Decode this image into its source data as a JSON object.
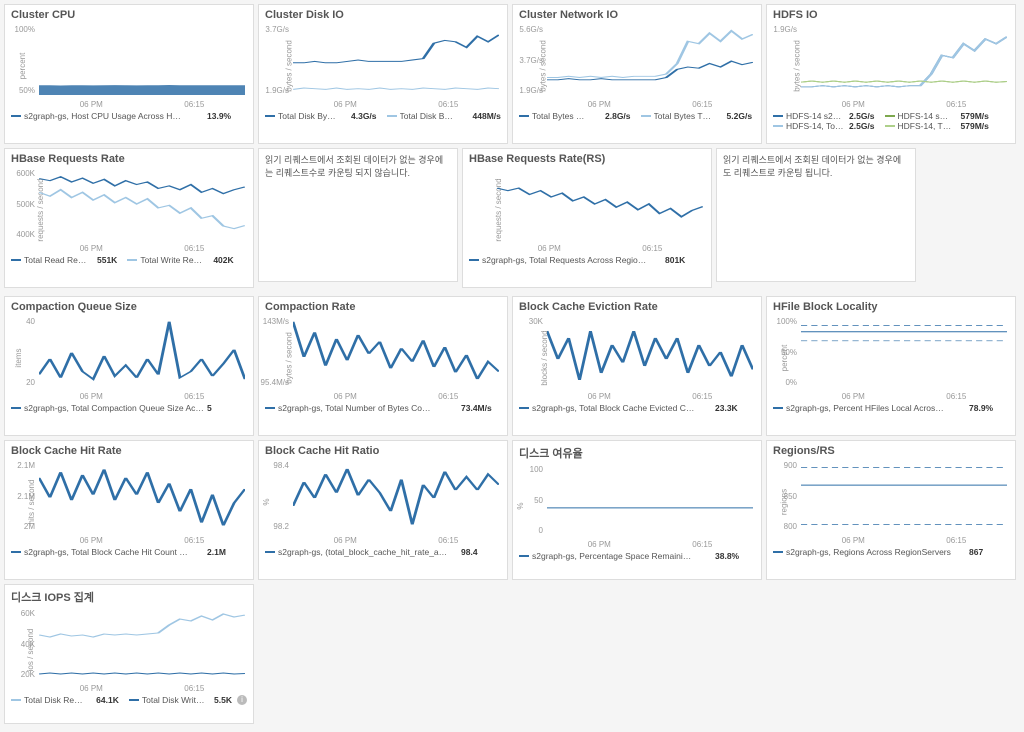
{
  "chart_data": [
    {
      "type": "area",
      "id": "cluster-cpu",
      "title": "Cluster CPU",
      "ylabel": "percent",
      "xticks": [
        "06 PM",
        "06:15"
      ],
      "yticks": [
        "100%",
        "50%"
      ],
      "series": [
        {
          "name": "s2graph-gs, Host CPU Usage Across H…",
          "color": "#2f6fa7",
          "value": "13.9%",
          "values": [
            14,
            14,
            13.5,
            14,
            14,
            13.8,
            14,
            14.1,
            14,
            13.7,
            14,
            14,
            14.2,
            14,
            14,
            13.9,
            14,
            14,
            14,
            14
          ]
        }
      ],
      "ylim": [
        0,
        100
      ]
    },
    {
      "type": "line",
      "id": "cluster-disk-io",
      "title": "Cluster Disk IO",
      "ylabel": "bytes / second",
      "xticks": [
        "06 PM",
        "06:15"
      ],
      "yticks": [
        "3.7G/s",
        "1.9G/s"
      ],
      "series": [
        {
          "name": "Total Disk By…",
          "color": "#2f6fa7",
          "value": "4.3G/s",
          "values": [
            2.3,
            2.3,
            2.4,
            2.3,
            2.3,
            2.4,
            2.5,
            2.4,
            2.4,
            2.4,
            2.4,
            2.5,
            2.6,
            3.7,
            3.9,
            3.8,
            3.4,
            4.2,
            3.8,
            4.3
          ]
        },
        {
          "name": "Total Disk B…",
          "color": "#9fc6e3",
          "value": "448M/s",
          "values": [
            0.4,
            0.5,
            0.45,
            0.4,
            0.5,
            0.4,
            0.45,
            0.4,
            0.5,
            0.4,
            0.45,
            0.4,
            0.5,
            0.45,
            0.4,
            0.5,
            0.45,
            0.4,
            0.5,
            0.45
          ]
        }
      ],
      "ylim": [
        0,
        5
      ]
    },
    {
      "type": "line",
      "id": "cluster-net-io",
      "title": "Cluster Network IO",
      "ylabel": "bytes / second",
      "xticks": [
        "06 PM",
        "06:15"
      ],
      "yticks": [
        "5.6G/s",
        "3.7G/s",
        "1.9G/s"
      ],
      "series": [
        {
          "name": "Total Bytes …",
          "color": "#2f6fa7",
          "value": "2.8G/s",
          "values": [
            1.3,
            1.3,
            1.4,
            1.3,
            1.3,
            1.4,
            1.3,
            1.3,
            1.3,
            1.3,
            1.3,
            1.5,
            2.2,
            2.4,
            2.3,
            2.7,
            2.4,
            2.9,
            2.6,
            2.8
          ]
        },
        {
          "name": "Total Bytes T…",
          "color": "#9fc6e3",
          "value": "5.2G/s",
          "values": [
            1.5,
            1.5,
            1.6,
            1.5,
            1.6,
            1.5,
            1.6,
            1.5,
            1.6,
            1.6,
            1.6,
            1.8,
            2.7,
            4.6,
            4.4,
            5.3,
            4.6,
            5.5,
            4.8,
            5.2
          ]
        }
      ],
      "ylim": [
        0,
        6
      ]
    },
    {
      "type": "line",
      "id": "hdfs-io",
      "title": "HDFS IO",
      "ylabel": "bytes / second",
      "xticks": [
        "06 PM",
        "06:15"
      ],
      "yticks": [
        "1.9G/s"
      ],
      "legend_cols": 2,
      "series": [
        {
          "name": "HDFS-14 s2…",
          "color": "#2f6fa7",
          "value": "2.5G/s",
          "values": [
            0.35,
            0.35,
            0.4,
            0.35,
            0.4,
            0.35,
            0.4,
            0.35,
            0.4,
            0.35,
            0.4,
            0.4,
            0.9,
            1.7,
            1.6,
            2.2,
            1.9,
            2.4,
            2.2,
            2.5
          ]
        },
        {
          "name": "HDFS-14 s…",
          "color": "#7da84e",
          "value": "579M/s",
          "values": [
            0.55,
            0.6,
            0.55,
            0.6,
            0.55,
            0.6,
            0.55,
            0.6,
            0.55,
            0.6,
            0.55,
            0.6,
            0.55,
            0.6,
            0.55,
            0.6,
            0.55,
            0.6,
            0.55,
            0.58
          ]
        },
        {
          "name": "HDFS-14, To…",
          "color": "#9fc6e3",
          "value": "2.5G/s",
          "values": [
            0.35,
            0.35,
            0.4,
            0.35,
            0.4,
            0.35,
            0.4,
            0.35,
            0.4,
            0.35,
            0.4,
            0.4,
            0.9,
            1.7,
            1.6,
            2.2,
            1.9,
            2.4,
            2.2,
            2.5
          ]
        },
        {
          "name": "HDFS-14, T…",
          "color": "#aed08a",
          "value": "579M/s",
          "values": [
            0.55,
            0.6,
            0.55,
            0.6,
            0.55,
            0.6,
            0.55,
            0.6,
            0.55,
            0.6,
            0.55,
            0.6,
            0.55,
            0.6,
            0.55,
            0.6,
            0.55,
            0.6,
            0.55,
            0.58
          ]
        }
      ],
      "ylim": [
        0,
        3
      ]
    },
    {
      "type": "line",
      "id": "hbase-req-rate",
      "title": "HBase Requests Rate",
      "ylabel": "requests / second",
      "xticks": [
        "06 PM",
        "06:15"
      ],
      "yticks": [
        "600K",
        "500K",
        "400K"
      ],
      "note": "읽기 리퀘스트에서 조회된 데이터가 없는 경우에는 리퀘스트수로 카운팅 되지 않습니다.",
      "series": [
        {
          "name": "Total Read Re…",
          "color": "#2f6fa7",
          "value": "551K",
          "values": [
            583,
            575,
            590,
            570,
            585,
            565,
            580,
            555,
            575,
            560,
            570,
            545,
            555,
            540,
            560,
            530,
            545,
            525,
            540,
            551
          ]
        },
        {
          "name": "Total Write Re…",
          "color": "#9fc6e3",
          "value": "402K",
          "values": [
            530,
            515,
            540,
            510,
            530,
            500,
            520,
            490,
            510,
            485,
            505,
            470,
            480,
            450,
            470,
            430,
            440,
            400,
            390,
            402
          ]
        }
      ],
      "ylim": [
        350,
        620
      ]
    },
    {
      "type": "line",
      "id": "hbase-req-rate-rs",
      "title": "HBase Requests Rate(RS)",
      "ylabel": "requests / second",
      "xticks": [
        "06 PM",
        "06:15"
      ],
      "yticks": [],
      "note": "읽기 리퀘스트에서 조회된 데이터가 없는 경우에도 리퀘스트로 카운팅 됩니다.",
      "series": [
        {
          "name": "s2graph-gs, Total Requests Across Regio…",
          "color": "#2f6fa7",
          "value": "801K",
          "values": [
            830,
            826,
            830,
            820,
            826,
            816,
            822,
            810,
            816,
            805,
            812,
            800,
            808,
            796,
            805,
            790,
            798,
            785,
            795,
            801
          ]
        }
      ],
      "ylim": [
        750,
        860
      ]
    },
    {
      "type": "line",
      "id": "compaction-queue",
      "title": "Compaction Queue Size",
      "ylabel": "items",
      "xticks": [
        "06 PM",
        "06:15"
      ],
      "yticks": [
        "40",
        "20"
      ],
      "series": [
        {
          "name": "s2graph-gs, Total Compaction Queue Size Ac…",
          "color": "#2f6fa7",
          "value": "5",
          "values": [
            8,
            18,
            6,
            22,
            10,
            5,
            20,
            7,
            14,
            6,
            18,
            8,
            42,
            6,
            10,
            18,
            7,
            15,
            24,
            5
          ]
        }
      ],
      "ylim": [
        0,
        45
      ]
    },
    {
      "type": "line",
      "id": "compaction-rate",
      "title": "Compaction Rate",
      "ylabel": "bytes / second",
      "xticks": [
        "06 PM",
        "06:15"
      ],
      "yticks": [
        "143M/s",
        "95.4M/s"
      ],
      "series": [
        {
          "name": "s2graph-gs, Total Number of Bytes Co…",
          "color": "#2f6fa7",
          "value": "73.4M/s",
          "values": [
            148,
            95,
            132,
            82,
            122,
            90,
            128,
            100,
            118,
            78,
            108,
            88,
            120,
            80,
            110,
            72,
            98,
            62,
            88,
            73
          ]
        }
      ],
      "ylim": [
        50,
        155
      ]
    },
    {
      "type": "line",
      "id": "block-evict",
      "title": "Block Cache Eviction Rate",
      "ylabel": "blocks / second",
      "xticks": [
        "06 PM",
        "06:15"
      ],
      "yticks": [
        "30K"
      ],
      "series": [
        {
          "name": "s2graph-gs, Total Block Cache Evicted C…",
          "color": "#2f6fa7",
          "value": "23.3K",
          "values": [
            34,
            26,
            32,
            20,
            34,
            22,
            30,
            25,
            34,
            24,
            32,
            26,
            32,
            22,
            30,
            24,
            28,
            21,
            30,
            23
          ]
        }
      ],
      "ylim": [
        18,
        38
      ]
    },
    {
      "type": "line",
      "id": "hfile-locality",
      "title": "HFile Block Locality",
      "ylabel": "percent",
      "xticks": [
        "06 PM",
        "06:15"
      ],
      "yticks": [
        "100%",
        "50%",
        "0%"
      ],
      "dashed": true,
      "series": [
        {
          "name": "s2graph-gs, Percent HFiles Local Acros…",
          "color": "#2f6fa7",
          "value": "78.9%",
          "values": [
            79,
            79,
            79,
            79,
            79,
            79,
            79,
            79,
            79,
            79,
            79,
            79,
            79,
            79,
            79,
            79,
            79,
            79,
            79,
            79
          ]
        }
      ],
      "extra_lines": [
        {
          "values": [
            88,
            88,
            88,
            88,
            88,
            88,
            88,
            88,
            88,
            88,
            88,
            88,
            88,
            88,
            88,
            88,
            88,
            88,
            88,
            88
          ],
          "dash": true
        },
        {
          "values": [
            66,
            66,
            66,
            66,
            66,
            66,
            66,
            66,
            66,
            66,
            66,
            66,
            66,
            66,
            66,
            66,
            66,
            66,
            66,
            66
          ],
          "dash": true
        }
      ],
      "ylim": [
        0,
        100
      ]
    },
    {
      "type": "line",
      "id": "block-hit-rate",
      "title": "Block Cache Hit Rate",
      "ylabel": "hits / second",
      "xticks": [
        "06 PM",
        "06:15"
      ],
      "yticks": [
        "2.1M",
        "2.1M",
        "2M"
      ],
      "series": [
        {
          "name": "s2graph-gs, Total Block Cache Hit Count …",
          "color": "#2f6fa7",
          "value": "2.1M",
          "values": [
            2.14,
            2.07,
            2.16,
            2.06,
            2.15,
            2.08,
            2.17,
            2.06,
            2.14,
            2.08,
            2.16,
            2.05,
            2.12,
            2.02,
            2.1,
            1.98,
            2.08,
            1.97,
            2.05,
            2.1
          ]
        }
      ],
      "ylim": [
        1.95,
        2.2
      ]
    },
    {
      "type": "line",
      "id": "block-hit-ratio",
      "title": "Block Cache Hit Ratio",
      "ylabel": "%",
      "xticks": [
        "06 PM",
        "06:15"
      ],
      "yticks": [
        "98.4",
        "98.2"
      ],
      "series": [
        {
          "name": "s2graph-gs, (total_block_cache_hit_rate_a…",
          "color": "#2f6fa7",
          "value": "98.4",
          "values": [
            98.24,
            98.42,
            98.3,
            98.48,
            98.34,
            98.52,
            98.32,
            98.44,
            98.34,
            98.2,
            98.44,
            98.1,
            98.4,
            98.3,
            98.5,
            98.36,
            98.46,
            98.36,
            98.48,
            98.4
          ]
        }
      ],
      "ylim": [
        98.05,
        98.58
      ]
    },
    {
      "type": "line",
      "id": "disk-free",
      "title": "디스크 여유율",
      "ylabel": "%",
      "xticks": [
        "06 PM",
        "06:15"
      ],
      "yticks": [
        "100",
        "50",
        "0"
      ],
      "series": [
        {
          "name": "s2graph-gs, Percentage Space Remaini…",
          "color": "#2f6fa7",
          "value": "38.8%",
          "values": [
            38.8,
            38.8,
            38.8,
            38.8,
            38.8,
            38.8,
            38.8,
            38.8,
            38.8,
            38.8,
            38.8,
            38.8,
            38.8,
            38.8,
            38.8,
            38.8,
            38.8,
            38.8,
            38.8,
            38.8
          ]
        }
      ],
      "ylim": [
        0,
        100
      ]
    },
    {
      "type": "line",
      "id": "regions-rs",
      "title": "Regions/RS",
      "ylabel": "regions",
      "xticks": [
        "06 PM",
        "06:15"
      ],
      "yticks": [
        "900",
        "850",
        "800"
      ],
      "series": [
        {
          "name": "s2graph-gs, Regions Across RegionServers",
          "color": "#2f6fa7",
          "value": "867",
          "values": [
            867,
            867,
            867,
            867,
            867,
            867,
            867,
            867,
            867,
            867,
            867,
            867,
            867,
            867,
            867,
            867,
            867,
            867,
            867,
            867
          ]
        }
      ],
      "extra_lines": [
        {
          "values": [
            895,
            895,
            895,
            895,
            895,
            895,
            895,
            895,
            895,
            895,
            895,
            895,
            895,
            895,
            895,
            895,
            895,
            895,
            895,
            895
          ],
          "dash": true
        },
        {
          "values": [
            805,
            805,
            805,
            805,
            805,
            805,
            805,
            805,
            805,
            805,
            805,
            805,
            805,
            805,
            805,
            805,
            805,
            805,
            805,
            805
          ],
          "dash": true
        }
      ],
      "ylim": [
        795,
        905
      ]
    },
    {
      "type": "line",
      "id": "disk-iops",
      "title": "디스크 IOPS 집계",
      "ylabel": "ios / second",
      "xticks": [
        "06 PM",
        "06:15"
      ],
      "yticks": [
        "60K",
        "40K",
        "20K"
      ],
      "series": [
        {
          "name": "Total Disk Re…",
          "color": "#9fc6e3",
          "value": "64.1K",
          "values": [
            44,
            42,
            45,
            43,
            44,
            42,
            45,
            44,
            45,
            44,
            45,
            46,
            54,
            60,
            58,
            63,
            59,
            65,
            62,
            64
          ]
        },
        {
          "name": "Total Disk Writ…",
          "color": "#2f6fa7",
          "value": "5.5K",
          "info": true,
          "values": [
            5,
            6,
            5,
            6,
            5,
            6,
            5,
            6,
            5,
            6,
            5,
            6,
            5,
            6,
            5,
            6,
            5,
            6,
            5,
            5.5
          ]
        }
      ],
      "ylim": [
        0,
        70
      ]
    }
  ]
}
